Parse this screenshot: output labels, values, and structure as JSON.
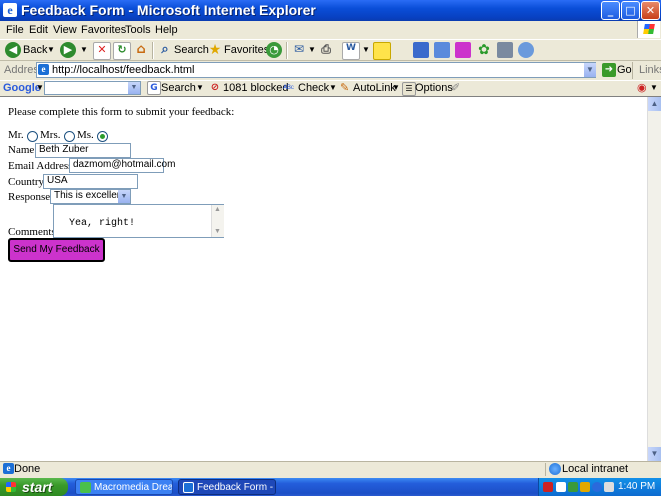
{
  "window": {
    "title": "Feedback Form - Microsoft Internet Explorer",
    "controls": {
      "minimize": "_",
      "maximize": "□",
      "close": "✕"
    }
  },
  "menu": [
    "File",
    "Edit",
    "View",
    "Favorites",
    "Tools",
    "Help"
  ],
  "toolbar": {
    "back_label": "Back",
    "search_label": "Search",
    "favorites_label": "Favorites"
  },
  "address": {
    "label": "Address",
    "url": "http://localhost/feedback.html",
    "go_label": "Go",
    "links_label": "Links"
  },
  "google_toolbar": {
    "logo": "Google",
    "search_label": "Search",
    "blocked_label": "1081 blocked",
    "check_label": "Check",
    "autolink_label": "AutoLink",
    "options_label": "Options"
  },
  "page": {
    "intro": "Please complete this form to submit your feedback:",
    "titles": [
      {
        "label": "Mr.",
        "selected": false
      },
      {
        "label": "Mrs.",
        "selected": false
      },
      {
        "label": "Ms.",
        "selected": true
      }
    ],
    "name_label": "Name:",
    "name_value": "Beth Zuber",
    "email_label": "Email Address:",
    "email_value": "dazmom@hotmail.com",
    "country_label": "Country:",
    "country_value": "USA",
    "response_label": "Response:",
    "response_value": "This is excellent",
    "comments_label": "Comments:",
    "comments_value": "Yea, right!",
    "submit_label": "Send My Feedback"
  },
  "status": {
    "text": "Done",
    "zone": "Local intranet"
  },
  "taskbar": {
    "start_label": "start",
    "tasks": [
      {
        "label": "Macromedia Drea...",
        "active": false
      },
      {
        "label": "Feedback Form - ...",
        "active": true
      }
    ],
    "clock": "1:40 PM"
  }
}
